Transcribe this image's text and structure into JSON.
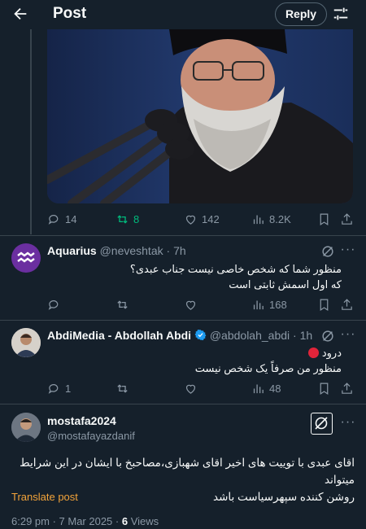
{
  "header": {
    "title": "Post",
    "reply_label": "Reply"
  },
  "main_media": {
    "alt": "photo"
  },
  "parent_stats": {
    "replies": "14",
    "reposts": "8",
    "likes": "142",
    "views": "8.2K"
  },
  "replies": [
    {
      "name": "Aquarius",
      "handle": "@neveshtak",
      "time": "7h",
      "lines": [
        "منظور شما که شخص خاصی نیست جناب عبدی؟",
        "که اول اسمش ثابتی است"
      ],
      "stats": {
        "replies": "",
        "reposts": "",
        "likes": "",
        "views": "168"
      }
    },
    {
      "name": "AbdiMedia - Abdollah Abdi",
      "handle": "@abdolah_abdi",
      "time": "1h",
      "lines": [
        "درود",
        "منظور من صرفاً یک شخص نیست"
      ],
      "stats": {
        "replies": "1",
        "reposts": "",
        "likes": "",
        "views": "48"
      }
    }
  ],
  "main_post": {
    "name": "mostafa2024",
    "handle": "@mostafayazdanif",
    "lines": [
      "اقای عبدی با توییت های اخیر اقای شهبازی،مصاحبخ با ایشان در این شرایط میتواند",
      "روشن کننده سپهرسیاست باشد"
    ],
    "translate_label": "Translate post",
    "timestamp": "6:29 pm · 7 Mar 2025 · ",
    "views_count": "6",
    "views_label": " Views"
  },
  "colors": {
    "background": "#15202b",
    "text": "#f7f9f9",
    "muted": "#8b98a5",
    "divider": "#38444d",
    "repost_active": "#00ba7c",
    "translate": "#f2a33a",
    "verified": "#1d9bf0"
  }
}
